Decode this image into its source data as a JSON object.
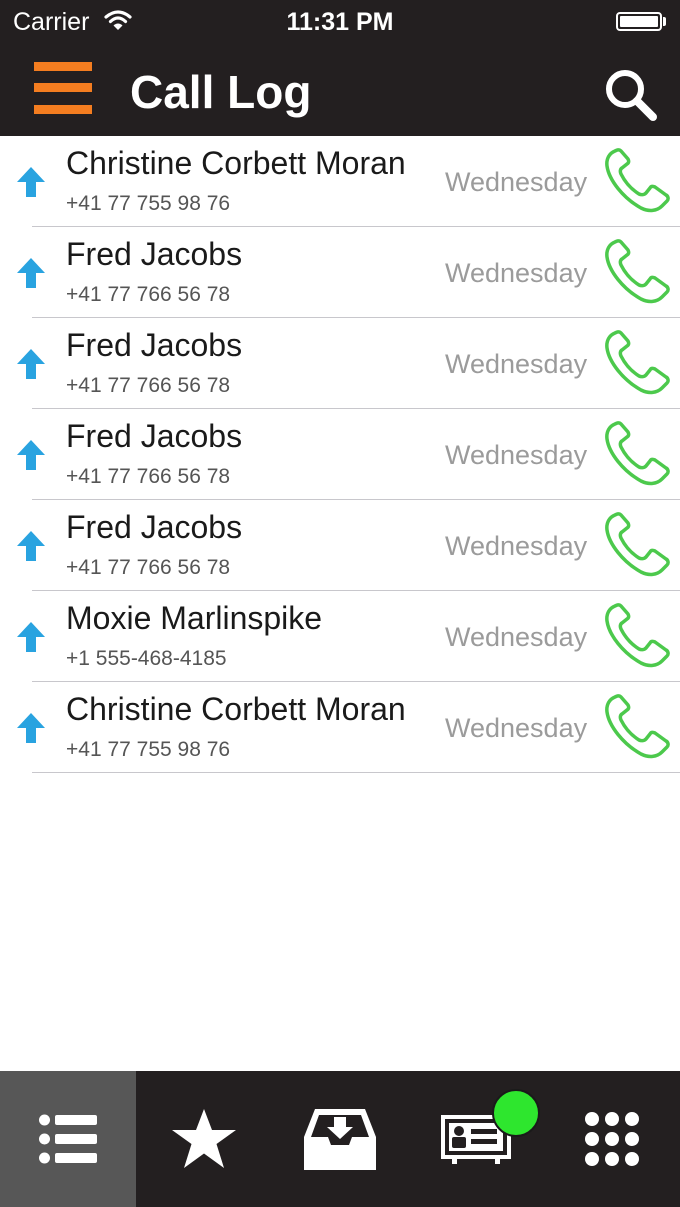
{
  "status_bar": {
    "carrier": "Carrier",
    "time": "11:31 PM",
    "wifi_icon": "wifi-icon",
    "battery_icon": "battery-icon"
  },
  "header": {
    "title": "Call Log",
    "menu_icon": "hamburger-menu-icon",
    "search_icon": "search-icon"
  },
  "calls": [
    {
      "name": "Christine Corbett Moran",
      "number": "+41 77 755 98 76",
      "day": "Wednesday",
      "direction": "outgoing"
    },
    {
      "name": "Fred Jacobs",
      "number": "+41 77 766 56 78",
      "day": "Wednesday",
      "direction": "outgoing"
    },
    {
      "name": "Fred Jacobs",
      "number": "+41 77 766 56 78",
      "day": "Wednesday",
      "direction": "outgoing"
    },
    {
      "name": "Fred Jacobs",
      "number": "+41 77 766 56 78",
      "day": "Wednesday",
      "direction": "outgoing"
    },
    {
      "name": "Fred Jacobs",
      "number": "+41 77 766 56 78",
      "day": "Wednesday",
      "direction": "outgoing"
    },
    {
      "name": "Moxie Marlinspike",
      "number": "+1 555-468-4185",
      "day": "Wednesday",
      "direction": "outgoing"
    },
    {
      "name": "Christine Corbett Moran",
      "number": "+41 77 755 98 76",
      "day": "Wednesday",
      "direction": "outgoing"
    }
  ],
  "tab_bar": {
    "tabs": [
      {
        "icon": "list-icon",
        "active": true
      },
      {
        "icon": "star-icon",
        "active": false
      },
      {
        "icon": "inbox-download-icon",
        "active": false
      },
      {
        "icon": "contact-card-icon",
        "active": false,
        "badge": "online-status-dot"
      },
      {
        "icon": "keypad-icon",
        "active": false
      }
    ]
  },
  "colors": {
    "bar_background": "#231f20",
    "accent_orange": "#f47d20",
    "outgoing_arrow": "#29a3e0",
    "call_green": "#4cc94c",
    "badge_green": "#2ee62e",
    "active_tab": "#575757"
  }
}
